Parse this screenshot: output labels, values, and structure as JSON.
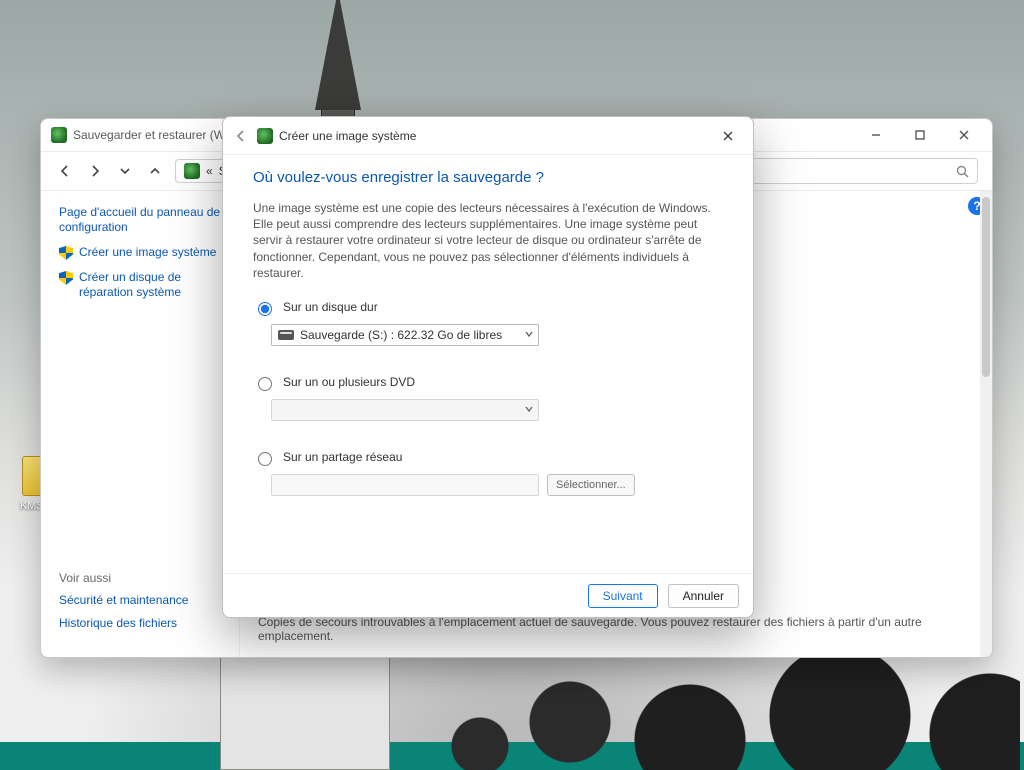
{
  "desktop": {
    "icon_label": "KMSA..."
  },
  "cp": {
    "title": "Sauvegarder et restaurer (Windows",
    "breadcrumb_prefix": "«",
    "breadcrumb": "Systèm",
    "help_badge": "?",
    "side": {
      "home": "Page d'accueil du panneau de configuration",
      "link_create_image": "Créer une image système",
      "link_create_repair": "Créer un disque de réparation système",
      "see_also": "Voir aussi",
      "link_security": "Sécurité et maintenance",
      "link_history": "Historique des fichiers"
    },
    "footer": "Copies de secours introuvables à l'emplacement actuel de sauvegarde. Vous pouvez restaurer des fichiers à partir d'un autre emplacement."
  },
  "wizard": {
    "title": "Créer une image système",
    "heading": "Où voulez-vous enregistrer la sauvegarde ?",
    "desc": "Une image système est une copie des lecteurs nécessaires à l'exécution de Windows. Elle peut aussi comprendre des lecteurs supplémentaires. Une image système peut servir à restaurer votre ordinateur si votre lecteur de disque ou ordinateur s'arrête de fonctionner. Cependant, vous ne pouvez pas sélectionner d'éléments individuels à restaurer.",
    "opt_hdd": "Sur un disque dur",
    "hdd_value": "Sauvegarde (S:) : 622.32 Go de libres",
    "opt_dvd": "Sur un ou plusieurs DVD",
    "opt_net": "Sur un partage réseau",
    "select_btn": "Sélectionner...",
    "next": "Suivant",
    "cancel": "Annuler"
  }
}
